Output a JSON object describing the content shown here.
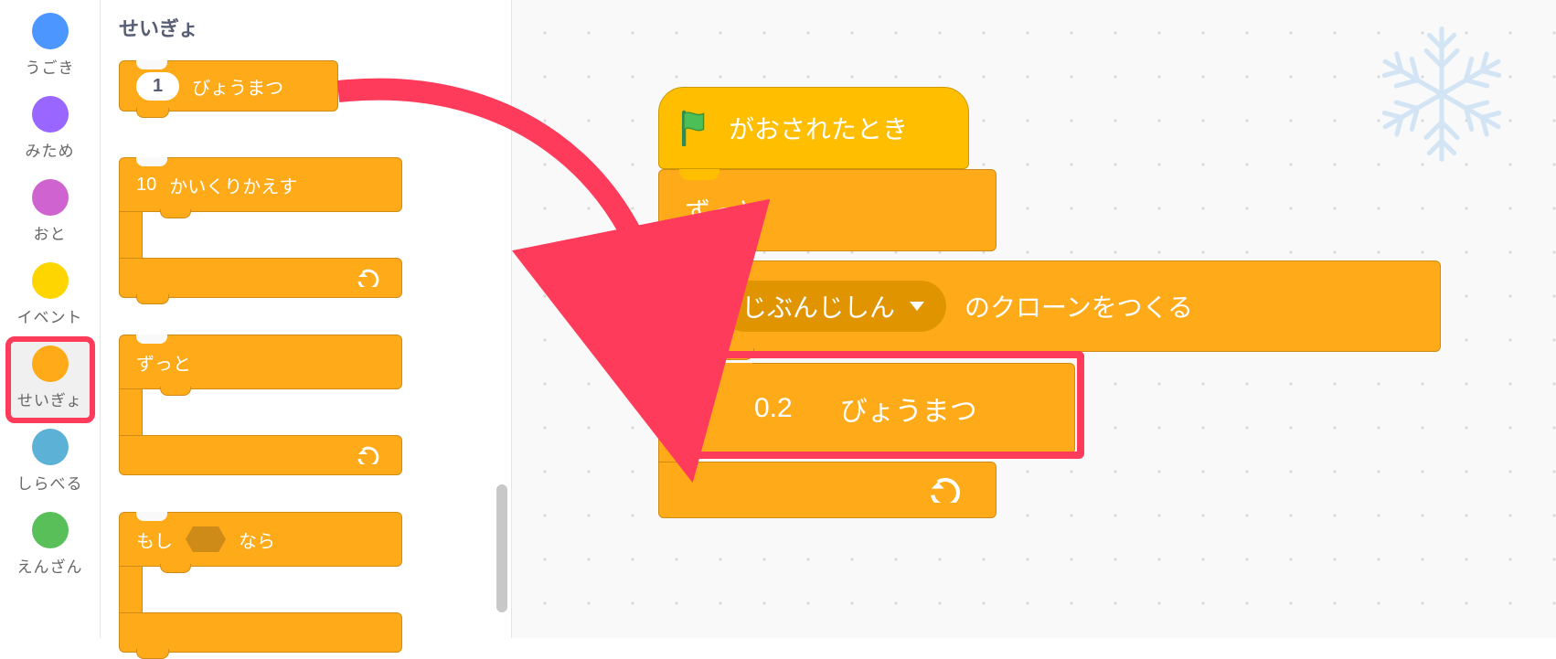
{
  "categories": [
    {
      "key": "motion",
      "label": "うごき"
    },
    {
      "key": "looks",
      "label": "みため"
    },
    {
      "key": "sound",
      "label": "おと"
    },
    {
      "key": "events",
      "label": "イベント"
    },
    {
      "key": "control",
      "label": "せいぎょ"
    },
    {
      "key": "sensing",
      "label": "しらべる"
    },
    {
      "key": "operators",
      "label": "えんざん"
    }
  ],
  "selectedCategoryIndex": 4,
  "palette": {
    "header": "せいぎょ",
    "wait": {
      "value": "1",
      "label": "びょうまつ"
    },
    "repeat": {
      "value": "10",
      "label": "かいくりかえす"
    },
    "forever": {
      "label": "ずっと"
    },
    "if": {
      "prefix": "もし",
      "suffix": "なら"
    }
  },
  "script": {
    "hat": {
      "label": "がおされたとき"
    },
    "forever": {
      "label": "ずっと"
    },
    "clone": {
      "dropdown": "じぶんじしん",
      "suffix": "のクローンをつくる"
    },
    "wait": {
      "value": "0.2",
      "label": "びょうまつ"
    }
  }
}
